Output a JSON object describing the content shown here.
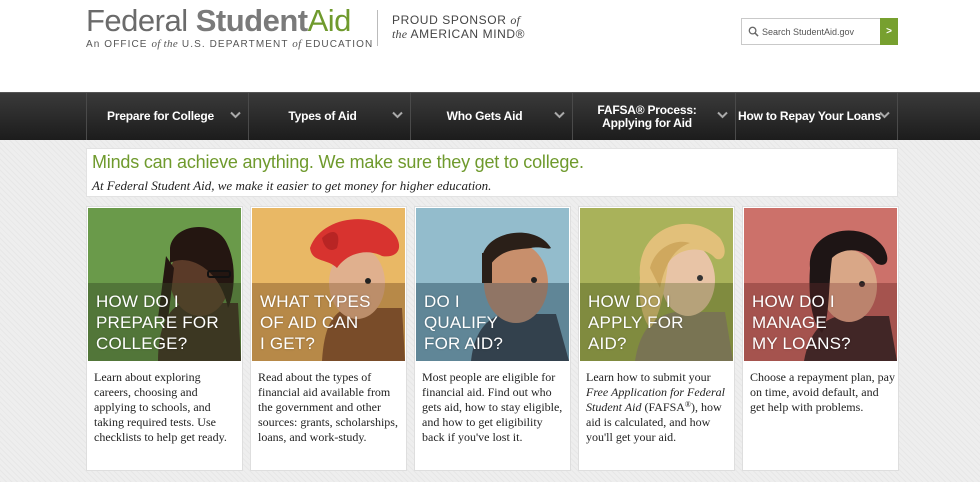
{
  "header": {
    "logo": {
      "federal": "Federal",
      "student": "Student",
      "aid": "Aid",
      "subtitle_pre": "An OFFICE ",
      "subtitle_of1": "of",
      "subtitle_the": " the",
      "subtitle_mid": " U.S. DEPARTMENT ",
      "subtitle_of2": "of",
      "subtitle_end": " EDUCATION"
    },
    "sponsor": {
      "line1": "PROUD SPONSOR",
      "line1_of": "of",
      "line2_the": "the",
      "line2": "AMERICAN MIND®"
    },
    "search": {
      "placeholder": "Search StudentAid.gov",
      "button_label": ">"
    }
  },
  "nav": {
    "items": [
      {
        "label": "Prepare for College"
      },
      {
        "label": "Types of Aid"
      },
      {
        "label": "Who Gets Aid"
      },
      {
        "label": "FAFSA® Process: Applying for Aid"
      },
      {
        "label": "How to Repay Your Loans"
      }
    ]
  },
  "intro": {
    "headline": "Minds can achieve anything. We make sure they get to college.",
    "subheadline": "At Federal Student Aid, we make it easier to get money for higher education."
  },
  "cards": [
    {
      "caption_lines": [
        "How do I",
        "prepare for",
        "college?"
      ],
      "text": "Learn about exploring careers, choosing and applying to schools, and taking required tests.  Use checklists to help get ready."
    },
    {
      "caption_lines": [
        "What types",
        "of aid can",
        "I get?"
      ],
      "text": "Read about the types of financial aid available from the government and other sources: grants, scholarships, loans, and work-study."
    },
    {
      "caption_lines": [
        "Do I",
        "qualify",
        "for aid?"
      ],
      "text": "Most people are eligible for financial aid. Find out who gets aid, how to stay eligible, and how to get eligibility back if you've lost it."
    },
    {
      "caption_lines": [
        "How do I",
        "apply for",
        "aid?"
      ],
      "text_pre": "Learn how to submit your ",
      "text_italic": "Free Application for Federal Student Aid",
      "text_mid": " (FAFSA",
      "text_sup": "®",
      "text_post": "), how aid is calculated, and how you'll get your aid."
    },
    {
      "caption_lines": [
        "How do I",
        "manage",
        "my loans?"
      ],
      "text": "Choose a repayment plan, pay on time, avoid default, and get help with problems."
    }
  ],
  "colors": {
    "brand_green": "#6f9a2d",
    "nav_background": "#2a2a2a",
    "card1_bg": "#6f9a4e",
    "card2_bg": "#e6b86a",
    "card3_bg": "#8fb7c8",
    "card4_bg": "#a8b055",
    "card5_bg": "#c9706a"
  },
  "icons": {
    "search": "search-icon",
    "nav_dropdown": "chevron-down-icon"
  }
}
